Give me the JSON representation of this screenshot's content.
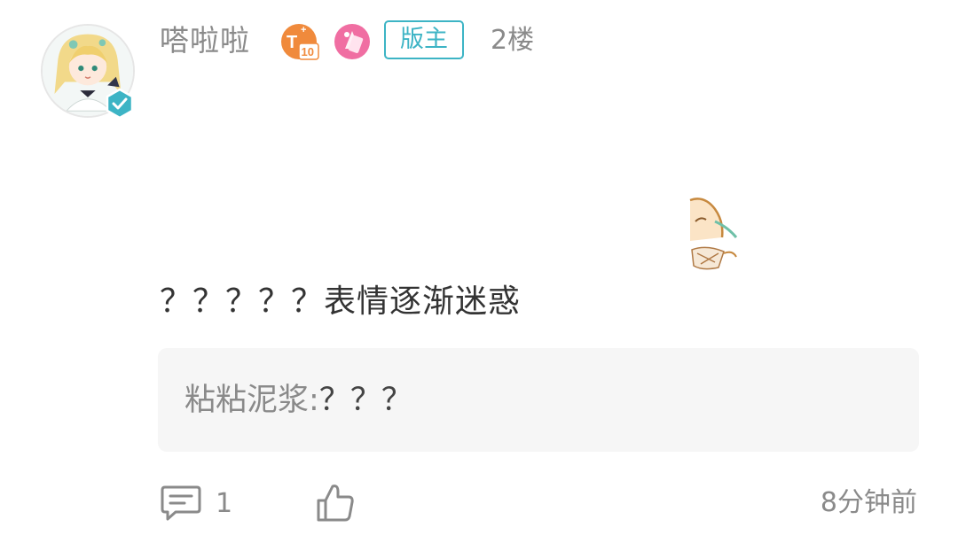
{
  "post": {
    "author": {
      "name": "嗒啦啦",
      "level_badge_text": "10",
      "role_badge": "版主",
      "verified": true
    },
    "floor": "2楼",
    "content": "？？？？？表情逐渐迷惑",
    "reply": {
      "author": "粘粘泥浆",
      "separator": ":",
      "text": "？？？"
    },
    "comment_count": "1",
    "time": "8分钟前"
  },
  "colors": {
    "accent": "#3db4c5",
    "muted_text": "#8a8a8a",
    "body_text": "#333333",
    "reply_bg": "#f6f6f6",
    "level_badge": "#f08a3c",
    "honor_badge": "#f06ea2"
  },
  "icons": {
    "verified": "verified-check-icon",
    "comment": "comment-bubble-icon",
    "like": "thumbs-up-icon"
  }
}
